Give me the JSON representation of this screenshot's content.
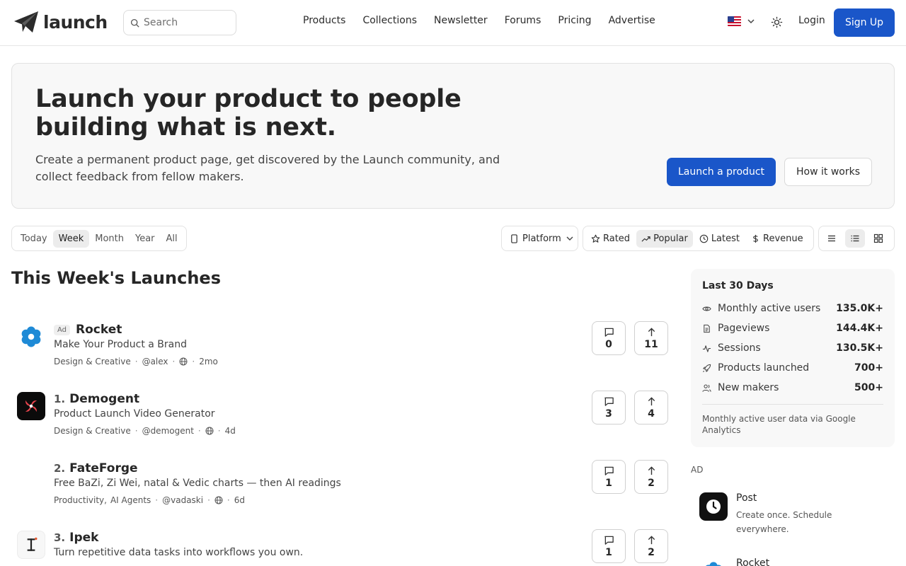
{
  "header": {
    "logo_text": "launch",
    "search_placeholder": "Search",
    "nav": [
      "Products",
      "Collections",
      "Newsletter",
      "Forums",
      "Pricing",
      "Advertise"
    ],
    "login": "Login",
    "signup": "Sign Up"
  },
  "hero": {
    "title": "Launch your product to people building what is next.",
    "subtitle": "Create a permanent product page, get discovered by the Launch community, and collect feedback from fellow makers.",
    "primary_cta": "Launch a product",
    "secondary_cta": "How it works"
  },
  "filters": {
    "periods": [
      "Today",
      "Week",
      "Month",
      "Year",
      "All"
    ],
    "active_period": "Week",
    "platform": "Platform",
    "sorts": [
      "Rated",
      "Popular",
      "Latest",
      "Revenue"
    ],
    "active_sort": "Popular"
  },
  "launches": {
    "title": "This Week's Launches",
    "items": [
      {
        "ad": "Ad",
        "rank": "",
        "name": "Rocket",
        "tagline": "Make Your Product a Brand",
        "categories": [
          "Design & Creative"
        ],
        "maker": "@alex",
        "age": "2mo",
        "comments": "0",
        "upvotes": "11"
      },
      {
        "ad": "",
        "rank": "1.",
        "name": "Demogent",
        "tagline": "Product Launch Video Generator",
        "categories": [
          "Design & Creative"
        ],
        "maker": "@demogent",
        "age": "4d",
        "comments": "3",
        "upvotes": "4"
      },
      {
        "ad": "",
        "rank": "2.",
        "name": "FateForge",
        "tagline": "Free BaZi, Zi Wei, natal & Vedic charts — then AI readings",
        "categories": [
          "Productivity,",
          "AI Agents"
        ],
        "maker": "@vadaski",
        "age": "6d",
        "comments": "1",
        "upvotes": "2"
      },
      {
        "ad": "",
        "rank": "3.",
        "name": "Ipek",
        "tagline": "Turn repetitive data tasks into workflows you own.",
        "categories": [],
        "maker": "",
        "age": "",
        "comments": "1",
        "upvotes": "2"
      }
    ]
  },
  "sidebar": {
    "stats_title": "Last 30 Days",
    "stats": [
      {
        "icon": "eye-icon",
        "label": "Monthly active users",
        "value": "135.0K+"
      },
      {
        "icon": "document-icon",
        "label": "Pageviews",
        "value": "144.4K+"
      },
      {
        "icon": "activity-icon",
        "label": "Sessions",
        "value": "130.5K+"
      },
      {
        "icon": "rocket-icon",
        "label": "Products launched",
        "value": "700+"
      },
      {
        "icon": "users-icon",
        "label": "New makers",
        "value": "500+"
      }
    ],
    "stats_note": "Monthly active user data via Google Analytics",
    "ad_label": "AD",
    "ads": [
      {
        "name": "Post",
        "desc": "Create once. Schedule everywhere."
      },
      {
        "name": "Rocket",
        "desc": ""
      }
    ]
  },
  "colors": {
    "accent": "#1a56c9",
    "border": "#e2e2e2",
    "panel": "#f8f8f8"
  }
}
